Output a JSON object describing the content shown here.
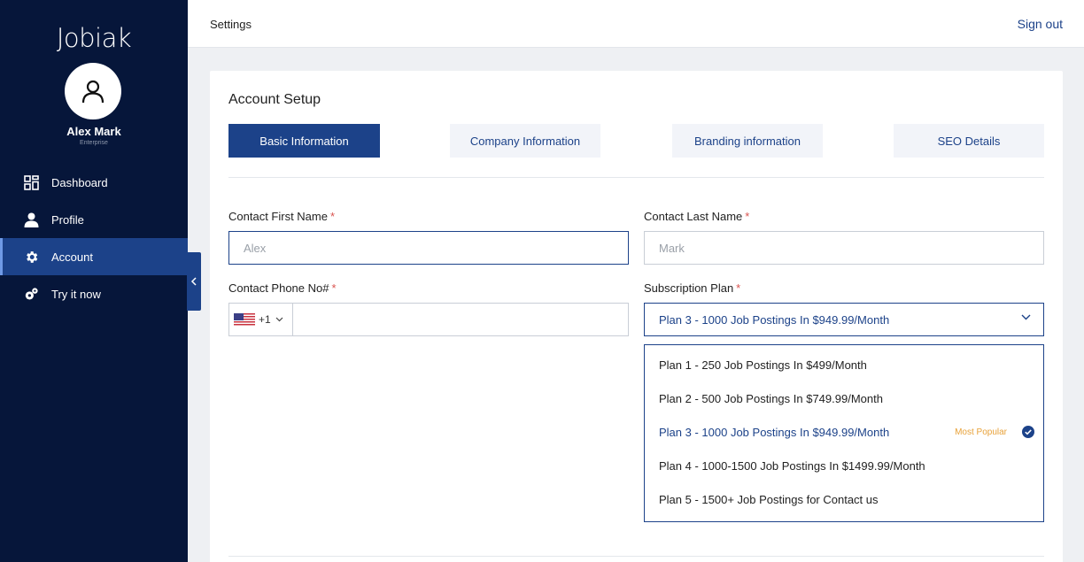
{
  "brand": {
    "logo": "Jobiak"
  },
  "user": {
    "name": "Alex Mark",
    "role": "Enterprise"
  },
  "nav": {
    "items": [
      {
        "label": "Dashboard",
        "icon": "dashboard-icon"
      },
      {
        "label": "Profile",
        "icon": "person-icon"
      },
      {
        "label": "Account",
        "icon": "gear-icon",
        "active": true
      },
      {
        "label": "Try it now",
        "icon": "gears-icon"
      }
    ]
  },
  "topbar": {
    "title": "Settings",
    "signout": "Sign out"
  },
  "card": {
    "title": "Account Setup",
    "tabs": [
      {
        "label": "Basic Information",
        "active": true
      },
      {
        "label": "Company Information"
      },
      {
        "label": "Branding information"
      },
      {
        "label": "SEO Details"
      }
    ]
  },
  "form": {
    "first_name": {
      "label": "Contact First Name",
      "required": "*",
      "placeholder": "Alex"
    },
    "last_name": {
      "label": "Contact Last Name",
      "required": "*",
      "placeholder": "Mark"
    },
    "phone": {
      "label": "Contact Phone No#",
      "required": "*",
      "country_code": "+1",
      "country_flag": "us-flag-icon",
      "value": ""
    },
    "plan": {
      "label": "Subscription Plan",
      "required": "*",
      "selected": "Plan 3 - 1000 Job Postings In $949.99/Month",
      "options": [
        {
          "label": "Plan 1 - 250 Job Postings In $499/Month"
        },
        {
          "label": "Plan 2 - 500 Job Postings In $749.99/Month"
        },
        {
          "label": "Plan 3 - 1000 Job Postings In $949.99/Month",
          "badge": "Most Popular",
          "selected": true
        },
        {
          "label": "Plan 4 - 1000-1500 Job Postings In $1499.99/Month"
        },
        {
          "label": "Plan 5 - 1500+ Job Postings for Contact us"
        }
      ]
    }
  },
  "colors": {
    "sidebar": "#06163a",
    "accent": "#1c4289",
    "popular": "#e8a23a",
    "required": "#d9534f"
  }
}
